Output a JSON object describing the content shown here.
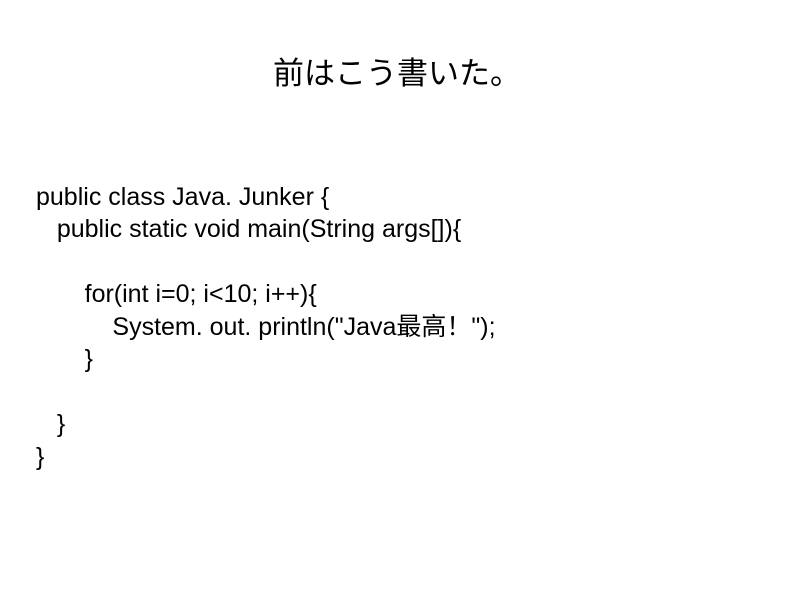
{
  "title": "前はこう書いた。",
  "code": {
    "line1": "public class Java. Junker {",
    "line2": "   public static void main(String args[]){",
    "line3": "　",
    "line4": "       for(int i=0; i<10; i++){",
    "line5": "           System. out. println(\"Java最高！\");",
    "line6": "       }",
    "line7": "　",
    "line8": "   }",
    "line9": "}"
  }
}
